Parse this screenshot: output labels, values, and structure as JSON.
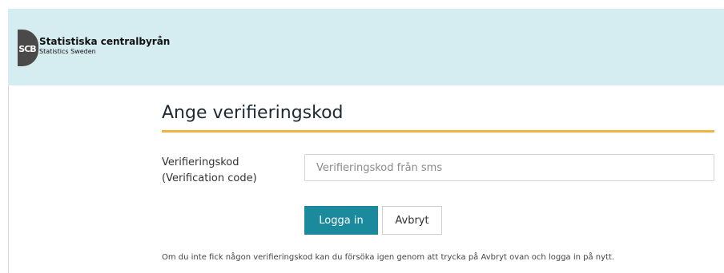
{
  "header": {
    "org_name": "Statistiska centralbyrån",
    "org_subtitle": "Statistics Sweden",
    "logo_letters": "SCB",
    "background_color": "#d5ecf0"
  },
  "main": {
    "title": "Ange verifieringskod",
    "title_rule_color": "#f0b43c",
    "field": {
      "label_line1": "Verifieringskod",
      "label_line2": "(Verification code)",
      "value": "",
      "placeholder": "Verifieringskod från sms"
    },
    "buttons": {
      "login_label": "Logga in",
      "login_color": "#1b8a9c",
      "cancel_label": "Avbryt"
    },
    "help_text": "Om du inte fick någon verifieringskod kan du försöka igen genom att trycka på Avbryt ovan och logga in på nytt."
  }
}
